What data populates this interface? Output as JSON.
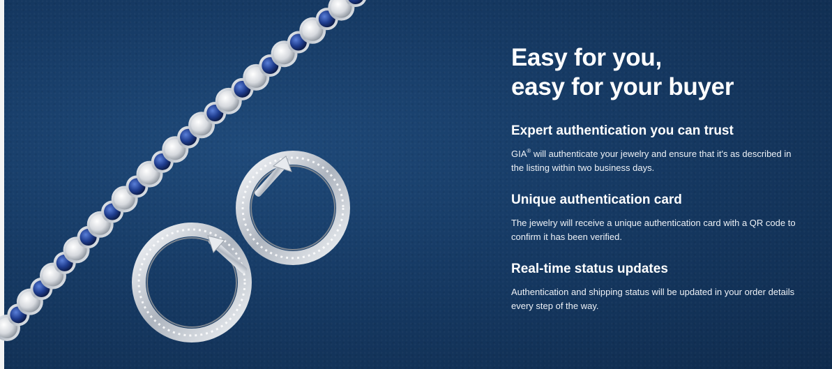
{
  "promo": {
    "headline": [
      "Easy for you,",
      "easy for your buyer"
    ],
    "features": [
      {
        "title": "Expert authentication you can trust",
        "desc_brand": "GIA",
        "desc_mark": "®",
        "desc": " will authenticate your jewelry and ensure that it's as described in the listing within two business days."
      },
      {
        "title": "Unique authentication card",
        "desc": "The jewelry will receive a unique authentication card with a QR code to confirm it has been verified."
      },
      {
        "title": "Real-time status updates",
        "desc": "Authentication and shipping status will be updated in your order details every step of the way."
      }
    ]
  },
  "colors": {
    "background": "#163a64",
    "sapphire": "#1f3d8f",
    "diamond": "#e6e6e6",
    "metal": "#d9dde3",
    "text": "#ffffff"
  },
  "image": {
    "subject": "sapphire-and-diamond-tennis-bracelet-and-hoop-earrings"
  }
}
